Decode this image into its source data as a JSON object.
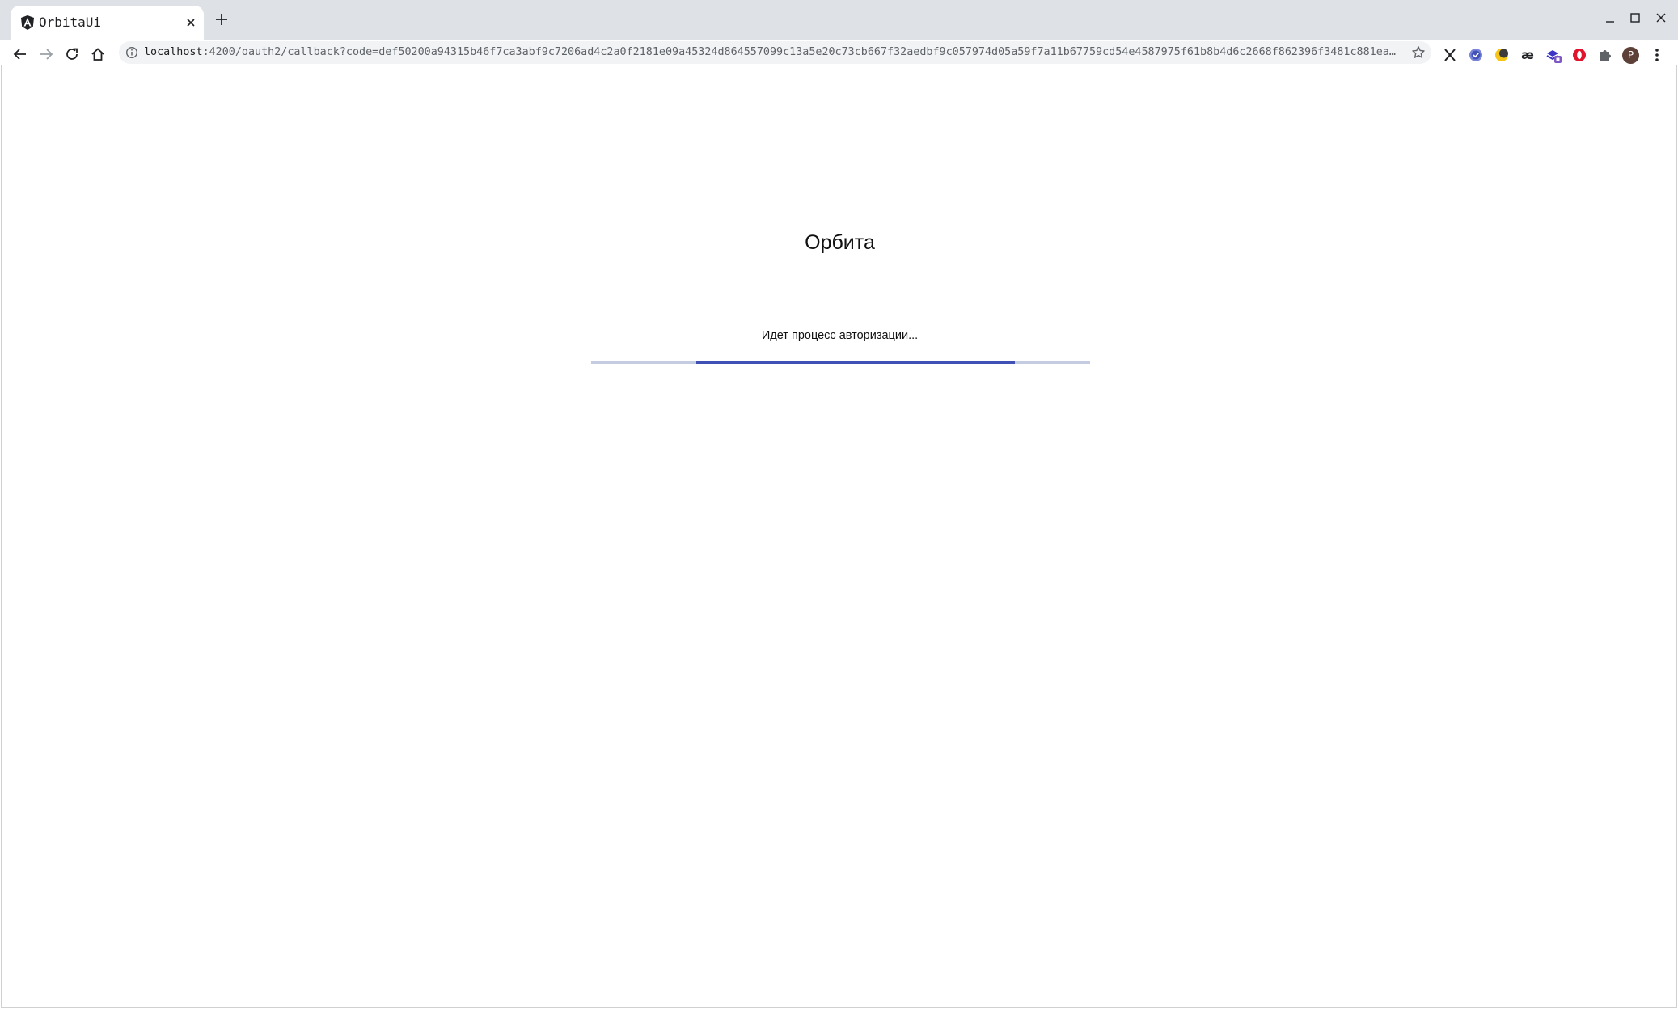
{
  "browser": {
    "tab": {
      "title": "OrbitaUi",
      "favicon": "angular-icon"
    },
    "address_bar": {
      "host": "localhost",
      "path": ":4200/oauth2/callback?code=def50200a94315b46f7ca3abf9c7206ad4c2a0f2181e09a45324d864557099c13a5e20c73cb667f32aedbf9c057974d05a59f7a11b67759cd54e4587975f61b8b4d6c2668f862396f3481c881eab4…"
    },
    "extensions": [
      "x-icon",
      "check-badge-icon",
      "moon-icon",
      "ae-icon",
      "stack-badge-icon",
      "opera-icon",
      "puzzle-icon"
    ],
    "profile_initial": "P"
  },
  "page": {
    "app_title": "Орбита",
    "status_text": "Идет процесс авторизации...",
    "progress": {
      "mode": "indeterminate",
      "segment_start_fraction": 0.21,
      "segment_end_fraction": 0.85,
      "track_color": "#c5cbe0",
      "bar_color": "#3f51b5"
    }
  }
}
